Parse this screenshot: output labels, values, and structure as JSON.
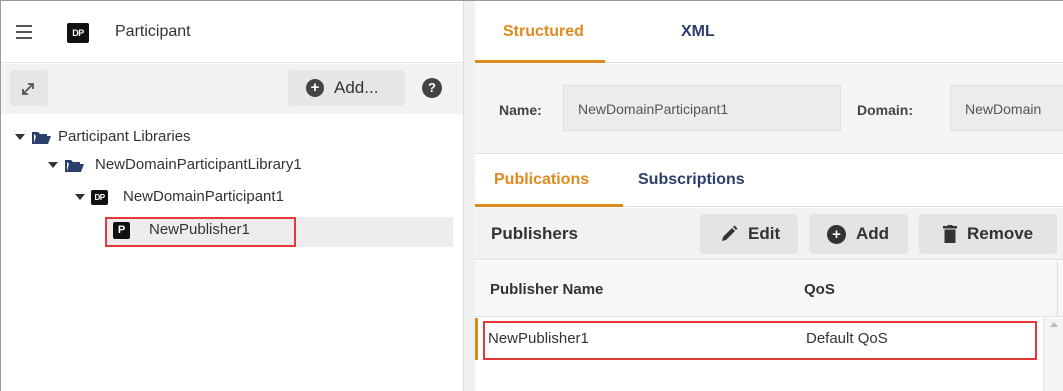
{
  "left_panel": {
    "header": {
      "badge": "DP",
      "title": "Participant"
    },
    "toolbar": {
      "add_label": "Add...",
      "help_glyph": "?"
    },
    "tree": [
      {
        "label": "Participant Libraries",
        "icon": "folder-open-icon"
      },
      {
        "label": "NewDomainParticipantLibrary1",
        "icon": "folder-open-icon"
      },
      {
        "label": "NewDomainParticipant1",
        "badge": "DP"
      },
      {
        "label": "NewPublisher1",
        "badge": "P",
        "selected": true
      }
    ]
  },
  "right_panel": {
    "tabs": [
      {
        "label": "Structured",
        "active": true
      },
      {
        "label": "XML",
        "active": false
      }
    ],
    "fields": {
      "name_label": "Name:",
      "name_value": "NewDomainParticipant1",
      "domain_label": "Domain:",
      "domain_value": "NewDomain"
    },
    "subtabs": [
      {
        "label": "Publications",
        "active": true
      },
      {
        "label": "Subscriptions",
        "active": false
      }
    ],
    "publishers": {
      "title": "Publishers",
      "edit_label": "Edit",
      "add_label": "Add",
      "remove_label": "Remove",
      "columns": [
        "Publisher Name",
        "QoS"
      ],
      "rows": [
        {
          "name": "NewPublisher1",
          "qos": "Default QoS"
        }
      ]
    }
  },
  "colors": {
    "accent": "#e08a1e",
    "tab_inactive": "#2c3e6b",
    "highlight": "#e53935"
  }
}
